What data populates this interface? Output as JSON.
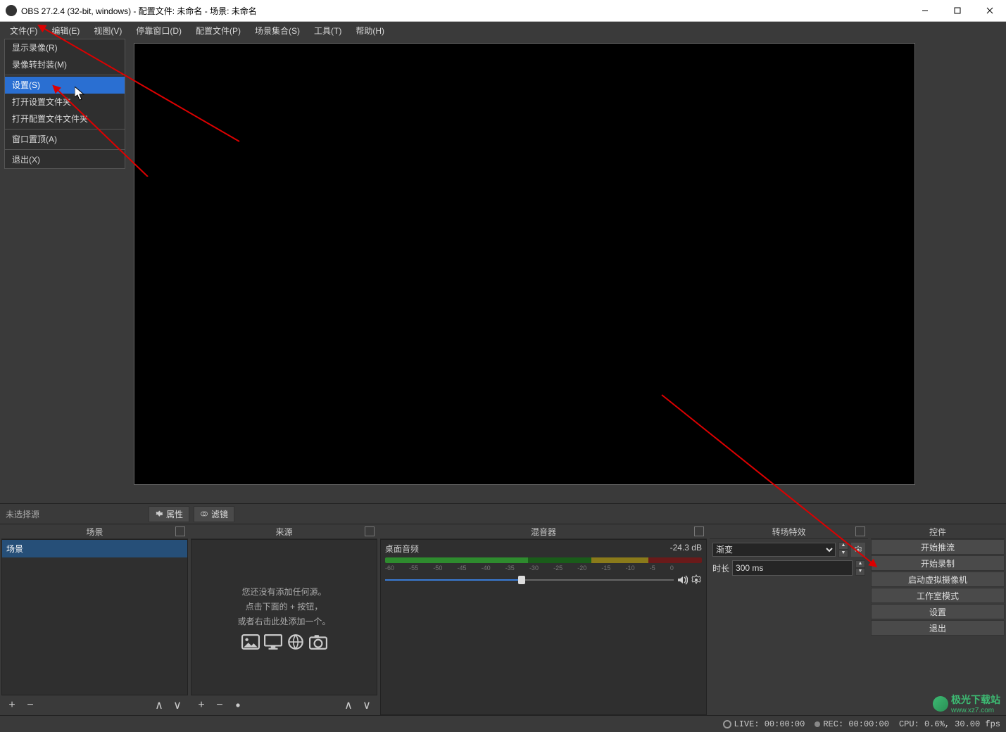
{
  "title": "OBS 27.2.4 (32-bit, windows) - 配置文件: 未命名 - 场景: 未命名",
  "menu": {
    "file": "文件(F)",
    "edit": "编辑(E)",
    "view": "视图(V)",
    "dock": "停靠窗口(D)",
    "profile": "配置文件(P)",
    "scene": "场景集合(S)",
    "tools": "工具(T)",
    "help": "帮助(H)"
  },
  "fileMenu": {
    "showRec": "显示录像(R)",
    "remux": "录像转封装(M)",
    "settings": "设置(S)",
    "openSettings": "打开设置文件夹",
    "openProfile": "打开配置文件文件夹",
    "alwaysTop": "窗口置顶(A)",
    "exit": "退出(X)"
  },
  "srcbar": {
    "none": "未选择源",
    "props": "属性",
    "filters": "滤镜"
  },
  "panels": {
    "scenes": "场景",
    "sources": "来源",
    "mixer": "混音器",
    "trans": "转场特效",
    "ctrl": "控件"
  },
  "scenes": {
    "item": "场景"
  },
  "sourcesEmpty": {
    "l1": "您还没有添加任何源。",
    "l2": "点击下面的 + 按钮，",
    "l3": "或者右击此处添加一个。"
  },
  "mixer": {
    "track": "桌面音频",
    "db": "-24.3 dB",
    "ticks": [
      "-60",
      "-55",
      "-50",
      "-45",
      "-40",
      "-35",
      "-30",
      "-25",
      "-20",
      "-15",
      "-10",
      "-5",
      "0"
    ]
  },
  "trans": {
    "type": "渐变",
    "durLabel": "时长",
    "dur": "300 ms"
  },
  "ctrl": {
    "stream": "开始推流",
    "record": "开始录制",
    "vcam": "启动虚拟摄像机",
    "studio": "工作室模式",
    "settings": "设置",
    "exit": "退出"
  },
  "status": {
    "live": "LIVE: 00:00:00",
    "rec": "REC: 00:00:00",
    "cpu": "CPU: 0.6%, 30.00 fps"
  },
  "watermark": {
    "name": "极光下载站",
    "url": "www.xz7.com"
  }
}
